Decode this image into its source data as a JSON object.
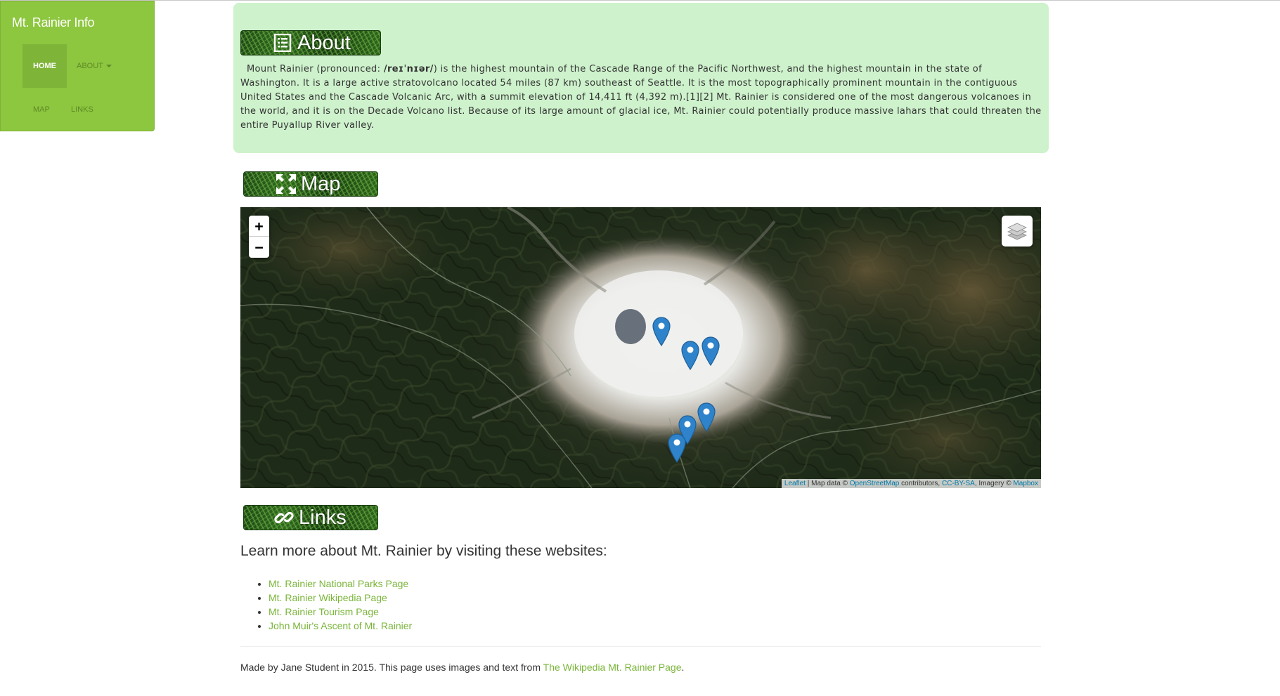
{
  "nav": {
    "brand": "Mt. Rainier Info",
    "home": "HOME",
    "about": "ABOUT",
    "map": "MAP",
    "links": "LINKS"
  },
  "about": {
    "heading": "About",
    "text_before": "Mount Rainier (pronounced: ",
    "pronunciation": "/reɪˈnɪər/",
    "text_after": ") is the highest mountain of the Cascade Range of the Pacific Northwest, and the highest mountain in the state of Washington. It is a large active stratovolcano located 54 miles (87 km) southeast of Seattle. It is the most topographically prominent mountain in the contiguous United States and the Cascade Volcanic Arc, with a summit elevation of 14,411 ft (4,392 m).[1][2] Mt. Rainier is considered one of the most dangerous volcanoes in the world, and it is on the Decade Volcano list. Because of its large amount of glacial ice, Mt. Rainier could potentially produce massive lahars that could threaten the entire Puyallup River valley."
  },
  "map": {
    "heading": "Map",
    "zoom_in": "+",
    "zoom_out": "−",
    "attribution": {
      "leaflet": "Leaflet",
      "sep1": " | Map data © ",
      "osm": "OpenStreetMap",
      "contributors": " contributors, ",
      "license": "CC-BY-SA",
      "imagery": ", Imagery © ",
      "mapbox": "Mapbox"
    },
    "marker_color": "#2e83cb",
    "marker_count": 6
  },
  "links": {
    "heading": "Links",
    "intro": "Learn more about Mt. Rainier by visiting these websites:",
    "items": [
      "Mt. Rainier National Parks Page",
      "Mt. Rainier Wikipedia Page",
      "Mt. Rainier Tourism Page",
      "John Muir's Ascent of Mt. Rainier"
    ]
  },
  "footer": {
    "text": "Made by Jane Student in 2015. This page uses images and text from ",
    "link": "The Wikipedia Mt. Rainier Page",
    "end": "."
  },
  "colors": {
    "sidebar": "#8dc63f",
    "about_bg": "#cef2cc",
    "link": "#7ab53a"
  }
}
